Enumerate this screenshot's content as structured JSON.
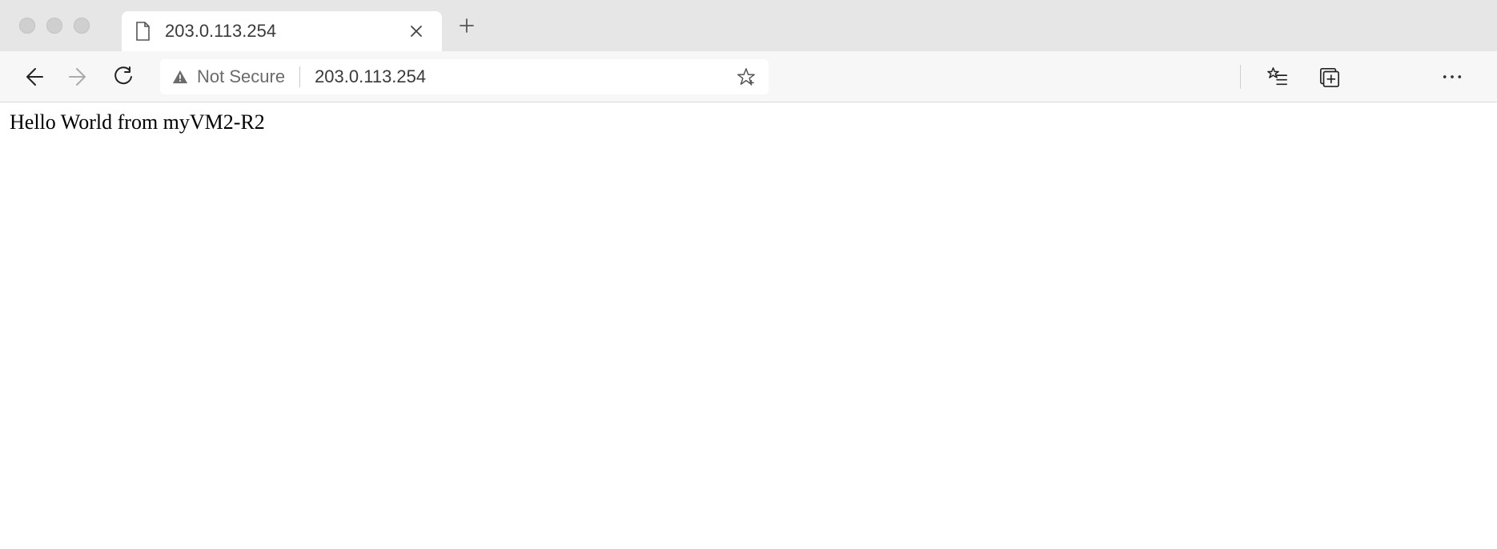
{
  "tab": {
    "title": "203.0.113.254"
  },
  "address_bar": {
    "security_label": "Not Secure",
    "url": "203.0.113.254"
  },
  "page": {
    "body_text": "Hello World from myVM2-R2"
  }
}
